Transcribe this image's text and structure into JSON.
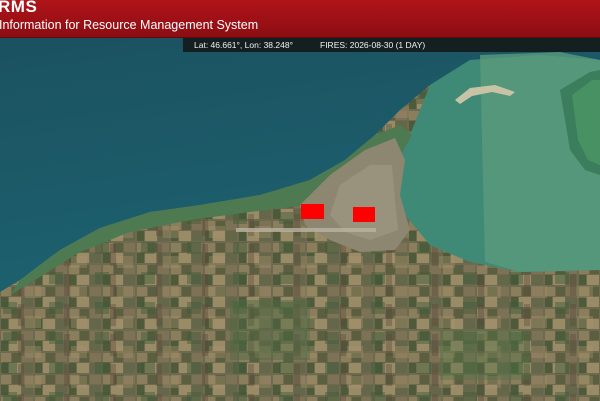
{
  "header": {
    "title": "RMS",
    "subtitle": "Information for Resource Management System"
  },
  "coordinates": {
    "readout": "Lat: 46.661°, Lon: 38.248°",
    "fires_label": "FIRES: 2026-08-30 (1 DAY)"
  },
  "fires": [
    {
      "id": "fire-1"
    },
    {
      "id": "fire-2"
    }
  ],
  "colors": {
    "header": "#a3111a",
    "fire": "#ff0000",
    "sea": "#1d5b67",
    "shallow": "#3e8f80",
    "land": "#6f6a4d"
  }
}
